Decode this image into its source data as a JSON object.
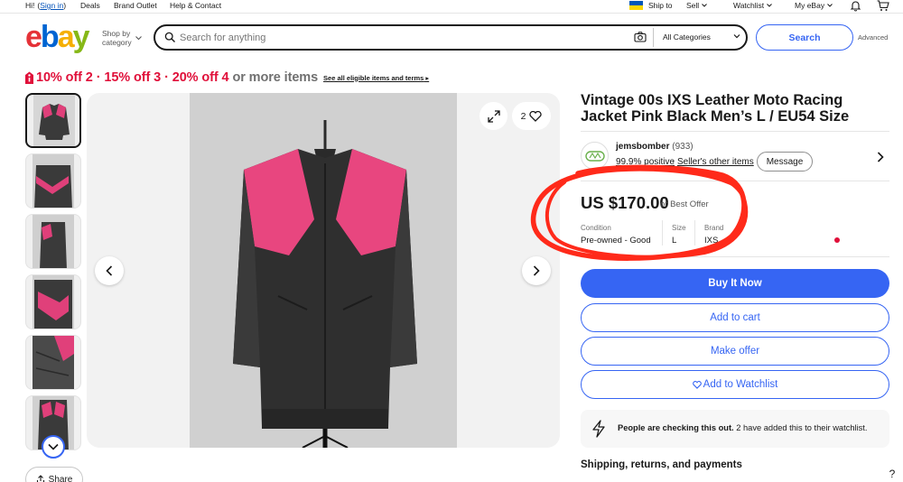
{
  "topbar": {
    "greeting": "Hi!",
    "sign_in": "Sign in",
    "deals": "Deals",
    "brand_outlet": "Brand Outlet",
    "help": "Help & Contact",
    "ship_to": "Ship to",
    "sell": "Sell",
    "watchlist": "Watchlist",
    "my_ebay": "My eBay"
  },
  "header": {
    "logo_letters": [
      "e",
      "b",
      "a",
      "y"
    ],
    "logo_colors": [
      "#e53238",
      "#0064d2",
      "#f5af02",
      "#86b817"
    ],
    "shop_by_line1": "Shop by",
    "shop_by_line2": "category",
    "search_placeholder": "Search for anything",
    "category_select": "All Categories",
    "search_button": "Search",
    "advanced": "Advanced"
  },
  "promo": {
    "offer1": "10% off 2",
    "offer2": "15% off 3",
    "offer3": "20% off 4",
    "tail": "or more items",
    "link": "See all eligible items and terms"
  },
  "gallery": {
    "watch_count": "2",
    "share_label": "Share"
  },
  "listing": {
    "title": "Vintage 00s IXS Leather Moto Racing Jacket Pink Black Men’s L / EU54 Size",
    "price": "US $170.00",
    "best_offer": "or Best Offer",
    "specs": {
      "condition_label": "Condition",
      "condition_value": "Pre-owned - Good",
      "size_label": "Size",
      "size_value": "L",
      "brand_label": "Brand",
      "brand_value": "IXS"
    }
  },
  "seller": {
    "name": "jemsbomber",
    "feedback_count": "(933)",
    "positive": "99.9% positive",
    "dot": "·",
    "other_items": "Seller's other items",
    "message": "Message"
  },
  "actions": {
    "buy_now": "Buy It Now",
    "add_to_cart": "Add to cart",
    "make_offer": "Make offer",
    "add_to_watchlist": "Add to Watchlist"
  },
  "notice": {
    "bold": "People are checking this out.",
    "rest": "2 have added this to their watchlist."
  },
  "shipping_header": "Shipping, returns, and payments",
  "help_mark": "?",
  "colors": {
    "accent": "#3665f3",
    "promo_red": "#e0103a",
    "link": "#0654ba",
    "annotation_red": "#ff2a1a"
  }
}
